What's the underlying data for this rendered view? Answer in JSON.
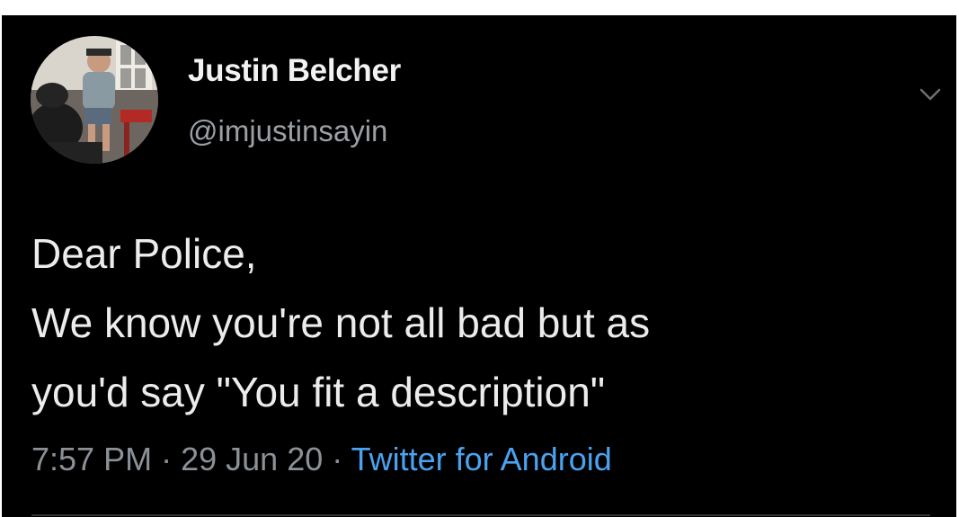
{
  "user": {
    "display_name": "Justin Belcher",
    "handle": "@imjustinsayin",
    "avatar_icon": "profile-photo"
  },
  "tweet": {
    "lines": [
      "Dear Police,",
      "We know you're not all bad but as",
      "you'd say \"You fit a description\""
    ],
    "time": "7:57 PM",
    "separator": "·",
    "date": "29 Jun 20",
    "source": "Twitter for Android"
  },
  "menu": {
    "icon": "chevron-down-icon"
  },
  "colors": {
    "background": "#000000",
    "text": "#ececec",
    "secondary": "#8b9197",
    "link": "#4aa3f0"
  }
}
